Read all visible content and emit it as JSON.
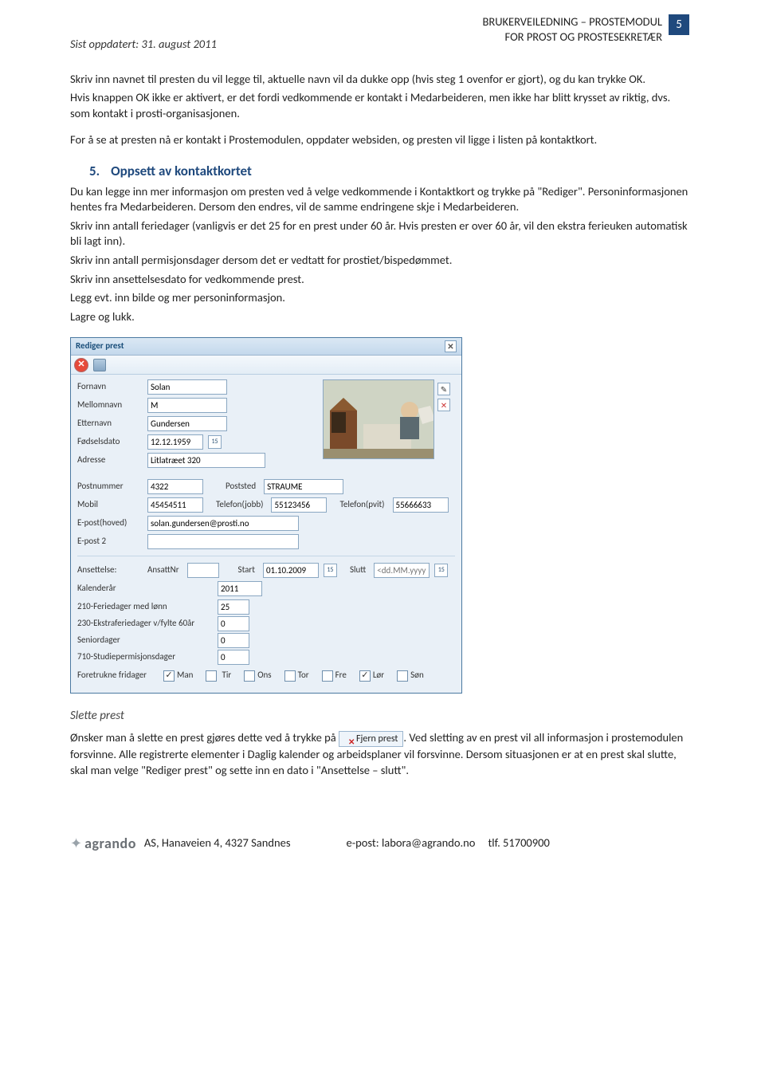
{
  "header": {
    "updated": "Sist oppdatert: 31. august 2011",
    "line1": "BRUKERVEILEDNING – PROSTEMODUL",
    "line2": "FOR PROST OG PROSTESEKRETÆR",
    "page": "5"
  },
  "intro": {
    "p1": "Skriv inn navnet til presten du vil legge til, aktuelle navn vil da dukke opp (hvis steg 1 ovenfor er gjort), og du kan trykke OK.",
    "p2": "Hvis knappen OK ikke er aktivert, er det fordi vedkommende er kontakt i Medarbeideren, men ikke har blitt krysset av riktig, dvs. som kontakt i prosti-organisasjonen.",
    "p3": "For å se at presten nå er kontakt i Prostemodulen, oppdater websiden, og presten vil ligge i listen på kontaktkort."
  },
  "section5": {
    "num": "5.",
    "title": "Oppsett av kontaktkortet",
    "p1": "Du kan legge inn mer informasjon om presten ved å velge vedkommende i Kontaktkort og trykke på \"Rediger\". Personinformasjonen hentes fra Medarbeideren. Dersom den endres, vil de samme endringene skje i Medarbeideren.",
    "p2": "Skriv inn antall feriedager (vanligvis er det 25 for en prest under 60 år. Hvis presten er over 60 år, vil den ekstra ferieuken automatisk bli lagt inn).",
    "p3": "Skriv inn antall permisjonsdager dersom det er vedtatt for prostiet/bispedømmet.",
    "p4": "Skriv inn ansettelsesdato for vedkommende prest.",
    "p5": "Legg evt. inn bilde og mer personinformasjon.",
    "p6": "Lagre og lukk."
  },
  "dialog": {
    "title": "Rediger prest",
    "labels": {
      "fornavn": "Fornavn",
      "mellomnavn": "Mellomnavn",
      "etternavn": "Etternavn",
      "fodselsdato": "Fødselsdato",
      "adresse": "Adresse",
      "postnummer": "Postnummer",
      "poststed": "Poststed",
      "mobil": "Mobil",
      "telefon_jobb": "Telefon(jobb)",
      "telefon_pvt": "Telefon(pvit)",
      "epost_hoved": "E-post(hoved)",
      "epost_2": "E-post 2",
      "ansettelse": "Ansettelse:",
      "ansattnr": "AnsattNr",
      "start": "Start",
      "slutt": "Slutt",
      "kalenderar": "Kalenderår",
      "feriedager": "210-Feriedager med lønn",
      "ekstraferie": "230-Ekstraferiedager v/fylte 60år",
      "seniordager": "Seniordager",
      "studieperm": "710-Studiepermisjonsdager",
      "foretrukne": "Foretrukne fridager"
    },
    "values": {
      "fornavn": "Solan",
      "mellomnavn": "M",
      "etternavn": "Gundersen",
      "fodselsdato": "12.12.1959",
      "adresse": "Litlatræet 320",
      "postnummer": "4322",
      "poststed": "STRAUME",
      "mobil": "45454511",
      "telefon_jobb": "55123456",
      "telefon_pvt": "55666633",
      "epost_hoved": "solan.gundersen@prosti.no",
      "epost_2": "",
      "ansattnr": "",
      "start": "01.10.2009",
      "slutt_placeholder": "<dd.MM.yyyy>",
      "kalenderar": "2011",
      "feriedager": "25",
      "ekstraferie": "0",
      "seniordager": "0",
      "studieperm": "0",
      "days": {
        "man": {
          "label": "Man",
          "checked": true
        },
        "tir": {
          "label": "Tir",
          "checked": false
        },
        "ons": {
          "label": "Ons",
          "checked": false
        },
        "tor": {
          "label": "Tor",
          "checked": false
        },
        "fre": {
          "label": "Fre",
          "checked": false
        },
        "lor": {
          "label": "Lør",
          "checked": true
        },
        "son": {
          "label": "Søn",
          "checked": false
        }
      }
    }
  },
  "slette": {
    "heading": "Slette prest",
    "pre": "Ønsker man å slette en prest gjøres dette ved å trykke på ",
    "chip": "Fjern prest",
    "post": ". Ved sletting av en prest vil all informasjon i prostemodulen forsvinne. Alle registrerte elementer i Daglig kalender og arbeidsplaner vil forsvinne. Dersom situasjonen er at en prest skal slutte, skal man velge \"Rediger prest\" og sette inn en dato i \"Ansettelse – slutt\"."
  },
  "footer": {
    "brand": "agrando",
    "addr": " AS, Hanaveien 4, 4327 Sandnes",
    "email": "e-post: labora@agrando.no",
    "tlf": "tlf. 51700900"
  }
}
